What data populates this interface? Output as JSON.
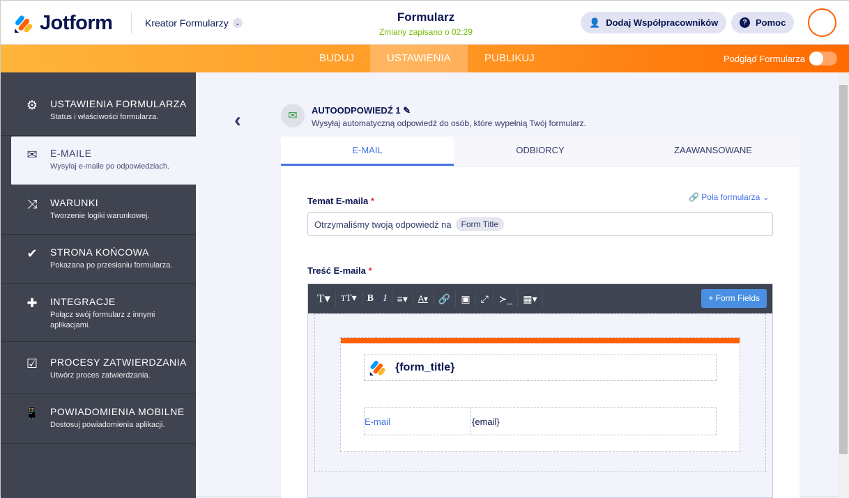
{
  "header": {
    "brand": "Jotform",
    "builder": "Kreator Formularzy",
    "title": "Formularz",
    "saved": "Zmiany zapisano o 02:29",
    "collab": "Dodaj Współpracowników",
    "help": "Pomoc"
  },
  "nav": {
    "tabs": [
      "BUDUJ",
      "USTAWIENIA",
      "PUBLIKUJ"
    ],
    "preview": "Podgląd Formularza"
  },
  "sidebar": [
    {
      "title": "USTAWIENIA FORMULARZA",
      "desc": "Status i właściwości formularza.",
      "icon": "gear-icon"
    },
    {
      "title": "E-MAILE",
      "desc": "Wysyłaj e-maile po odpowiedziach.",
      "icon": "envelope-icon"
    },
    {
      "title": "WARUNKI",
      "desc": "Tworzenie logiki warunkowej.",
      "icon": "shuffle-icon"
    },
    {
      "title": "STRONA KOŃCOWA",
      "desc": "Pokazana po przesłaniu formularza.",
      "icon": "check-circle-icon"
    },
    {
      "title": "INTEGRACJE",
      "desc": "Połącz swój formularz z innymi aplikacjami.",
      "icon": "puzzle-icon"
    },
    {
      "title": "PROCESY ZATWIERDZANIA",
      "desc": "Utwórz proces zatwierdzania.",
      "icon": "approval-icon"
    },
    {
      "title": "POWIADOMIENIA MOBILNE",
      "desc": "Dostosuj powiadomienia aplikacji.",
      "icon": "mobile-icon"
    }
  ],
  "autoresponder": {
    "title": "AUTOODPOWIEDŹ 1",
    "desc": "Wysyłaj automatyczną odpowiedź do osób, które wypełnią Twój formularz."
  },
  "tabs": [
    "E-MAIL",
    "ODBIORCY",
    "ZAAWANSOWANE"
  ],
  "subject": {
    "label": "Temat E-maila",
    "fields_link": "Pola formularza",
    "text": "Otrzymaliśmy twoją odpowiedź na",
    "chip": "Form Title"
  },
  "content": {
    "label": "Treść E-maila",
    "form_fields_btn": "+ Form Fields",
    "form_title_tag": "{form_title}",
    "row_label": "E-mail",
    "row_value": "{email}"
  }
}
